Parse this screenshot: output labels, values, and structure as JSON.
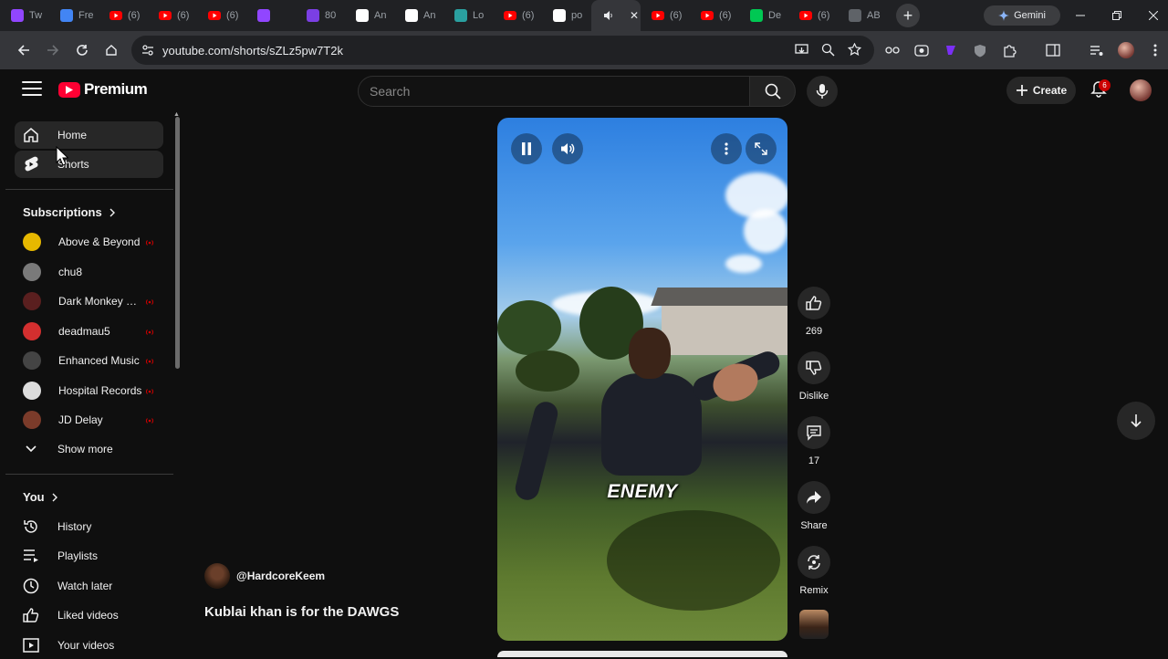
{
  "browser": {
    "tabs": [
      {
        "icon": "twitch-icon",
        "label": "Tw",
        "color": "#9146ff"
      },
      {
        "icon": "info-icon",
        "label": "Fre",
        "color": "#4285f4"
      },
      {
        "icon": "youtube-icon",
        "label": "(6)",
        "color": "#ff0000"
      },
      {
        "icon": "youtube-icon",
        "label": "(6)",
        "color": "#ff0000"
      },
      {
        "icon": "youtube-icon",
        "label": "(6)",
        "color": "#ff0000"
      },
      {
        "icon": "twitch-icon",
        "label": "",
        "color": "#9146ff"
      },
      {
        "icon": "app-icon",
        "label": "80",
        "color": "#7b3fe4"
      },
      {
        "icon": "amazon-icon",
        "label": "An",
        "color": "#ffffff"
      },
      {
        "icon": "amazon-icon",
        "label": "An",
        "color": "#ffffff"
      },
      {
        "icon": "globe-icon",
        "label": "Lo",
        "color": "#2aa0a0"
      },
      {
        "icon": "youtube-icon",
        "label": "(6)",
        "color": "#ff0000"
      },
      {
        "icon": "google-icon",
        "label": "po",
        "color": "#ffffff"
      },
      {
        "icon": "speaker-icon",
        "label": "",
        "color": "#e8eaed"
      },
      {
        "icon": "youtube-icon",
        "label": "(6)",
        "color": "#ff0000"
      },
      {
        "icon": "youtube-icon",
        "label": "(6)",
        "color": "#ff0000"
      },
      {
        "icon": "k-icon",
        "label": "De",
        "color": "#00c853"
      },
      {
        "icon": "youtube-icon",
        "label": "(6)",
        "color": "#ff0000"
      },
      {
        "icon": "app-icon",
        "label": "AB",
        "color": "#5f6368"
      }
    ],
    "gemini_label": "Gemini",
    "url": "youtube.com/shorts/sZLz5pw7T2k"
  },
  "header": {
    "logo_text": "Premium",
    "search_placeholder": "Search",
    "create_label": "Create",
    "notification_count": "6"
  },
  "sidebar": {
    "nav": [
      {
        "label": "Home",
        "icon": "home-icon"
      },
      {
        "label": "Shorts",
        "icon": "shorts-icon"
      }
    ],
    "subscriptions_title": "Subscriptions",
    "subscriptions": [
      {
        "name": "Above & Beyond",
        "color": "#e6b800",
        "live": true
      },
      {
        "name": "chu8",
        "color": "#7a7a7a",
        "live": false
      },
      {
        "name": "Dark Monkey Mu...",
        "color": "#5a1f1f",
        "live": true
      },
      {
        "name": "deadmau5",
        "color": "#d32f2f",
        "live": true
      },
      {
        "name": "Enhanced Music",
        "color": "#444444",
        "live": true
      },
      {
        "name": "Hospital Records",
        "color": "#dddddd",
        "live": true
      },
      {
        "name": "JD Delay",
        "color": "#7b3b2a",
        "live": true
      }
    ],
    "show_more": "Show more",
    "you_title": "You",
    "you_items": [
      {
        "label": "History",
        "icon": "history-icon"
      },
      {
        "label": "Playlists",
        "icon": "playlists-icon"
      },
      {
        "label": "Watch later",
        "icon": "clock-icon"
      },
      {
        "label": "Liked videos",
        "icon": "thumb-up-icon"
      },
      {
        "label": "Your videos",
        "icon": "video-icon"
      }
    ]
  },
  "short": {
    "caption": "ENEMY",
    "channel": "@HardcoreKeem",
    "title": "Kublai khan is for the DAWGS",
    "likes": "269",
    "dislike_label": "Dislike",
    "comments": "17",
    "share_label": "Share",
    "remix_label": "Remix"
  }
}
